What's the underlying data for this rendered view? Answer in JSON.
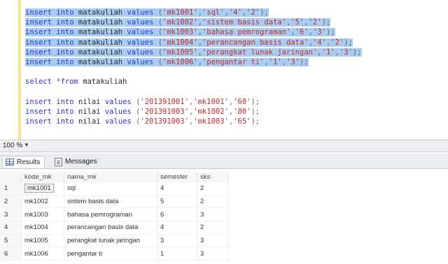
{
  "editor": {
    "lines": [
      {
        "selected": true,
        "tokens": [
          [
            "kw",
            "insert "
          ],
          [
            "kw",
            "into "
          ],
          [
            "id",
            "matakuliah "
          ],
          [
            "kw",
            "values "
          ],
          [
            "punc",
            "("
          ],
          [
            "str",
            "'mk1001'"
          ],
          [
            "punc",
            ","
          ],
          [
            "str",
            "'sql'"
          ],
          [
            "punc",
            ","
          ],
          [
            "str",
            "'4'"
          ],
          [
            "punc",
            ","
          ],
          [
            "str",
            "'2'"
          ],
          [
            "punc",
            ");"
          ]
        ]
      },
      {
        "selected": true,
        "tokens": [
          [
            "kw",
            "insert "
          ],
          [
            "kw",
            "into "
          ],
          [
            "id",
            "matakuliah "
          ],
          [
            "kw",
            "values "
          ],
          [
            "punc",
            "("
          ],
          [
            "str",
            "'mk1002'"
          ],
          [
            "punc",
            ","
          ],
          [
            "str",
            "'sistem basis data'"
          ],
          [
            "punc",
            ","
          ],
          [
            "str",
            "'5'"
          ],
          [
            "punc",
            ","
          ],
          [
            "str",
            "'2'"
          ],
          [
            "punc",
            ");"
          ]
        ]
      },
      {
        "selected": true,
        "tokens": [
          [
            "kw",
            "insert "
          ],
          [
            "kw",
            "into "
          ],
          [
            "id",
            "matakuliah "
          ],
          [
            "kw",
            "values "
          ],
          [
            "punc",
            "("
          ],
          [
            "str",
            "'mk1003'"
          ],
          [
            "punc",
            ","
          ],
          [
            "str",
            "'bahasa pemrograman'"
          ],
          [
            "punc",
            ","
          ],
          [
            "str",
            "'6'"
          ],
          [
            "punc",
            ","
          ],
          [
            "str",
            "'3'"
          ],
          [
            "punc",
            ");"
          ]
        ]
      },
      {
        "selected": true,
        "tokens": [
          [
            "kw",
            "insert "
          ],
          [
            "kw",
            "into "
          ],
          [
            "id",
            "matakuliah "
          ],
          [
            "kw",
            "values "
          ],
          [
            "punc",
            "("
          ],
          [
            "str",
            "'mk1004'"
          ],
          [
            "punc",
            ","
          ],
          [
            "str",
            "'perancangan basis data'"
          ],
          [
            "punc",
            ","
          ],
          [
            "str",
            "'4'"
          ],
          [
            "punc",
            ","
          ],
          [
            "str",
            "'2'"
          ],
          [
            "punc",
            ");"
          ]
        ]
      },
      {
        "selected": true,
        "tokens": [
          [
            "kw",
            "insert "
          ],
          [
            "kw",
            "into "
          ],
          [
            "id",
            "matakuliah "
          ],
          [
            "kw",
            "values "
          ],
          [
            "punc",
            "("
          ],
          [
            "str",
            "'mk1005'"
          ],
          [
            "punc",
            ","
          ],
          [
            "str",
            "'perangkat lunak jaringan'"
          ],
          [
            "punc",
            ","
          ],
          [
            "str",
            "'1'"
          ],
          [
            "punc",
            ","
          ],
          [
            "str",
            "'3'"
          ],
          [
            "punc",
            ");"
          ]
        ]
      },
      {
        "selected": true,
        "tokens": [
          [
            "kw",
            "insert "
          ],
          [
            "kw",
            "into "
          ],
          [
            "id",
            "matakuliah "
          ],
          [
            "kw",
            "values "
          ],
          [
            "punc",
            "("
          ],
          [
            "str",
            "'mk1006'"
          ],
          [
            "punc",
            ","
          ],
          [
            "str",
            "'pengantar ti'"
          ],
          [
            "punc",
            ","
          ],
          [
            "str",
            "'1'"
          ],
          [
            "punc",
            ","
          ],
          [
            "str",
            "'3'"
          ],
          [
            "punc",
            ");"
          ]
        ]
      },
      {
        "blank": true
      },
      {
        "selected": false,
        "tokens": [
          [
            "kw",
            "select "
          ],
          [
            "punc",
            "*"
          ],
          [
            "kw",
            "from "
          ],
          [
            "id",
            "matakuliah"
          ]
        ]
      },
      {
        "blank": true
      },
      {
        "selected": false,
        "tokens": [
          [
            "kw",
            "insert "
          ],
          [
            "kw",
            "into "
          ],
          [
            "id",
            "nilai "
          ],
          [
            "kw",
            "values "
          ],
          [
            "punc",
            "("
          ],
          [
            "str",
            "'201391001'"
          ],
          [
            "punc",
            ","
          ],
          [
            "str",
            "'mk1001'"
          ],
          [
            "punc",
            ","
          ],
          [
            "str",
            "'60'"
          ],
          [
            "punc",
            ");"
          ]
        ]
      },
      {
        "selected": false,
        "tokens": [
          [
            "kw",
            "insert "
          ],
          [
            "kw",
            "into "
          ],
          [
            "id",
            "nilai "
          ],
          [
            "kw",
            "values "
          ],
          [
            "punc",
            "("
          ],
          [
            "str",
            "'201391003'"
          ],
          [
            "punc",
            ","
          ],
          [
            "str",
            "'mk1002'"
          ],
          [
            "punc",
            ","
          ],
          [
            "str",
            "'80'"
          ],
          [
            "punc",
            ");"
          ]
        ]
      },
      {
        "selected": false,
        "tokens": [
          [
            "kw",
            "insert "
          ],
          [
            "kw",
            "into "
          ],
          [
            "id",
            "nilai "
          ],
          [
            "kw",
            "values "
          ],
          [
            "punc",
            "("
          ],
          [
            "str",
            "'201391003'"
          ],
          [
            "punc",
            ","
          ],
          [
            "str",
            "'mk1003'"
          ],
          [
            "punc",
            ","
          ],
          [
            "str",
            "'65'"
          ],
          [
            "punc",
            ");"
          ]
        ]
      }
    ]
  },
  "zoom": {
    "value": "100 %",
    "arrow": "▼"
  },
  "tabs": {
    "results": "Results",
    "messages": "Messages"
  },
  "results": {
    "columns": [
      "kode_mk",
      "nama_mk",
      "semester",
      "sks"
    ],
    "rows": [
      [
        "1",
        "mk1001",
        "sql",
        "4",
        "2"
      ],
      [
        "2",
        "mk1002",
        "sistem basis data",
        "5",
        "2"
      ],
      [
        "3",
        "mk1003",
        "bahasa pemrograman",
        "6",
        "3"
      ],
      [
        "4",
        "mk1004",
        "perancangan basis data",
        "4",
        "2"
      ],
      [
        "5",
        "mk1005",
        "perangkat lunak jaringan",
        "3",
        "3"
      ],
      [
        "6",
        "mk1006",
        "pengantar ti",
        "1",
        "3"
      ]
    ]
  }
}
